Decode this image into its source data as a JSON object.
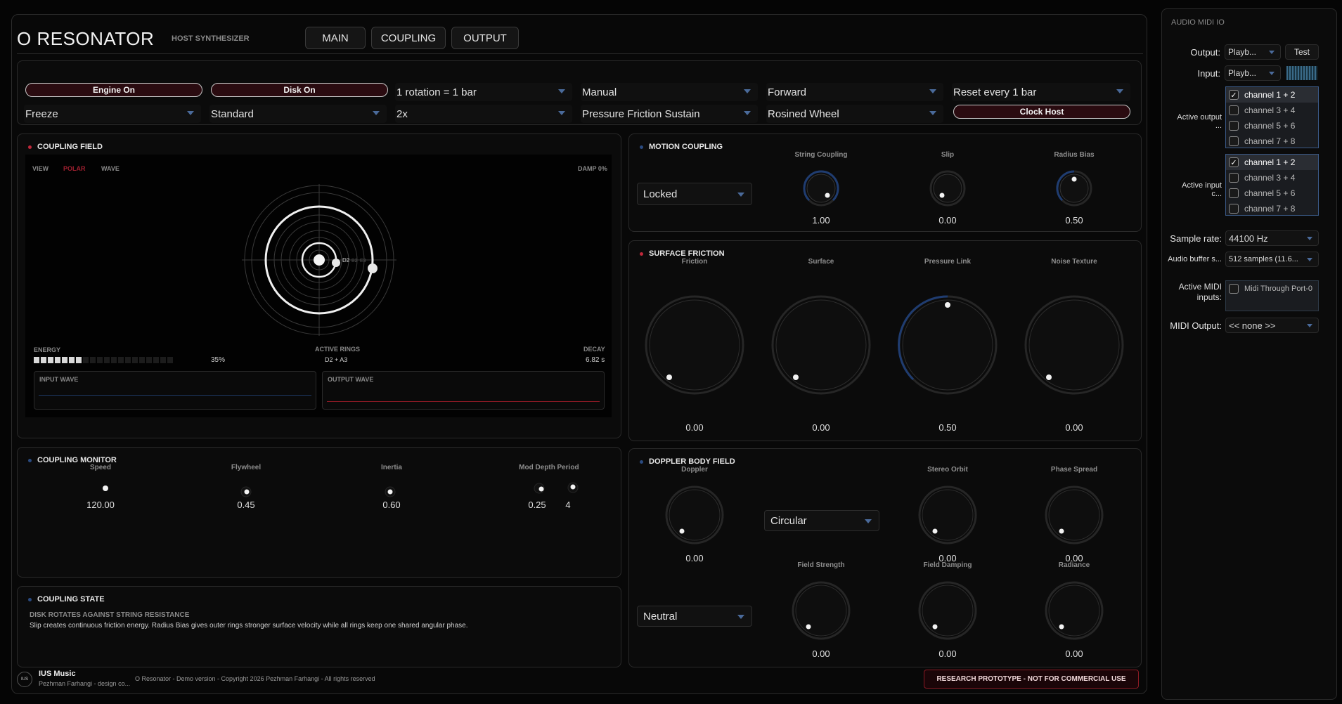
{
  "header": {
    "title": "O RESONATOR",
    "subtitle": "HOST SYNTHESIZER",
    "tabs": [
      "MAIN",
      "COUPLING",
      "OUTPUT"
    ]
  },
  "controls": {
    "engine_on": "Engine On",
    "disk_on": "Disk On",
    "clock_host": "Clock Host",
    "row1": [
      "1 rotation = 1 bar",
      "Manual",
      "Forward",
      "Reset every 1 bar"
    ],
    "row2": [
      "Freeze",
      "Standard",
      "2x",
      "Pressure Friction Sustain",
      "Rosined Wheel"
    ]
  },
  "coupling_field": {
    "title": "COUPLING FIELD",
    "view_label": "VIEW",
    "view_modes": [
      "POLAR",
      "WAVE"
    ],
    "damp": "DAMP 0%",
    "ring_labels": [
      "D2",
      "B2",
      "E3"
    ],
    "energy_label": "ENERGY",
    "energy_value": "35%",
    "energy_level": 0.35,
    "active_rings_label": "ACTIVE RINGS",
    "active_rings_value": "D2 + A3",
    "decay_label": "DECAY",
    "decay_value": "6.82 s",
    "input_wave": "INPUT WAVE",
    "output_wave": "OUTPUT WAVE"
  },
  "motion_coupling": {
    "title": "MOTION COUPLING",
    "mode": "Locked",
    "knobs": [
      {
        "label": "String Coupling",
        "value": "1.00"
      },
      {
        "label": "Slip",
        "value": "0.00"
      },
      {
        "label": "Radius Bias",
        "value": "0.50"
      }
    ]
  },
  "surface_friction": {
    "title": "SURFACE FRICTION",
    "knobs": [
      {
        "label": "Friction",
        "value": "0.00"
      },
      {
        "label": "Surface",
        "value": "0.00"
      },
      {
        "label": "Pressure Link",
        "value": "0.50"
      },
      {
        "label": "Noise Texture",
        "value": "0.00"
      }
    ]
  },
  "coupling_monitor": {
    "title": "COUPLING MONITOR",
    "knobs": [
      {
        "label": "Speed",
        "value": "120.00"
      },
      {
        "label": "Flywheel",
        "value": "0.45"
      },
      {
        "label": "Inertia",
        "value": "0.60"
      },
      {
        "label": "Mod Depth",
        "value": "0.25"
      },
      {
        "label": "Period",
        "value": "4"
      }
    ]
  },
  "coupling_state": {
    "title": "COUPLING STATE",
    "heading": "DISK ROTATES AGAINST STRING RESISTANCE",
    "body": "Slip creates continuous friction energy. Radius Bias gives outer rings stronger surface velocity while all rings keep one shared angular phase."
  },
  "doppler": {
    "title": "DOPPLER BODY FIELD",
    "mode1": "Circular",
    "mode2": "Neutral",
    "knobs": [
      {
        "label": "Doppler",
        "value": "0.00"
      },
      {
        "label": "Stereo Orbit",
        "value": "0.00"
      },
      {
        "label": "Phase Spread",
        "value": "0.00"
      },
      {
        "label": "Field Strength",
        "value": "0.00"
      },
      {
        "label": "Field Damping",
        "value": "0.00"
      },
      {
        "label": "Radiance",
        "value": "0.00"
      }
    ]
  },
  "footer": {
    "logo_text": "IUS",
    "brand": "IUS Music",
    "credit": "Pezhman Farhangi - design co...",
    "copyright": "O Resonator - Demo version - Copyright 2026 Pezhman Farhangi - All rights reserved",
    "badge": "RESEARCH PROTOTYPE - NOT FOR COMMERCIAL USE"
  },
  "audio_io": {
    "title": "AUDIO MIDI IO",
    "output_label": "Output:",
    "output_value": "Playb...",
    "test_label": "Test",
    "input_label": "Input:",
    "input_value": "Playb...",
    "active_output_label": "Active output ...",
    "active_input_label": "Active input c...",
    "channels": [
      "channel 1 + 2",
      "channel 3 + 4",
      "channel 5 + 6",
      "channel 7 + 8"
    ],
    "sample_rate_label": "Sample rate:",
    "sample_rate_value": "44100 Hz",
    "buffer_label": "Audio buffer s...",
    "buffer_value": "512 samples (11.6...",
    "midi_inputs_label": "Active MIDI inputs:",
    "midi_input_item": "Midi Through Port-0",
    "midi_output_label": "MIDI Output:",
    "midi_output_value": "<< none >>"
  },
  "colors": {
    "accent_red": "#c0283a",
    "accent_blue": "#2a4a80",
    "background": "#050505"
  }
}
